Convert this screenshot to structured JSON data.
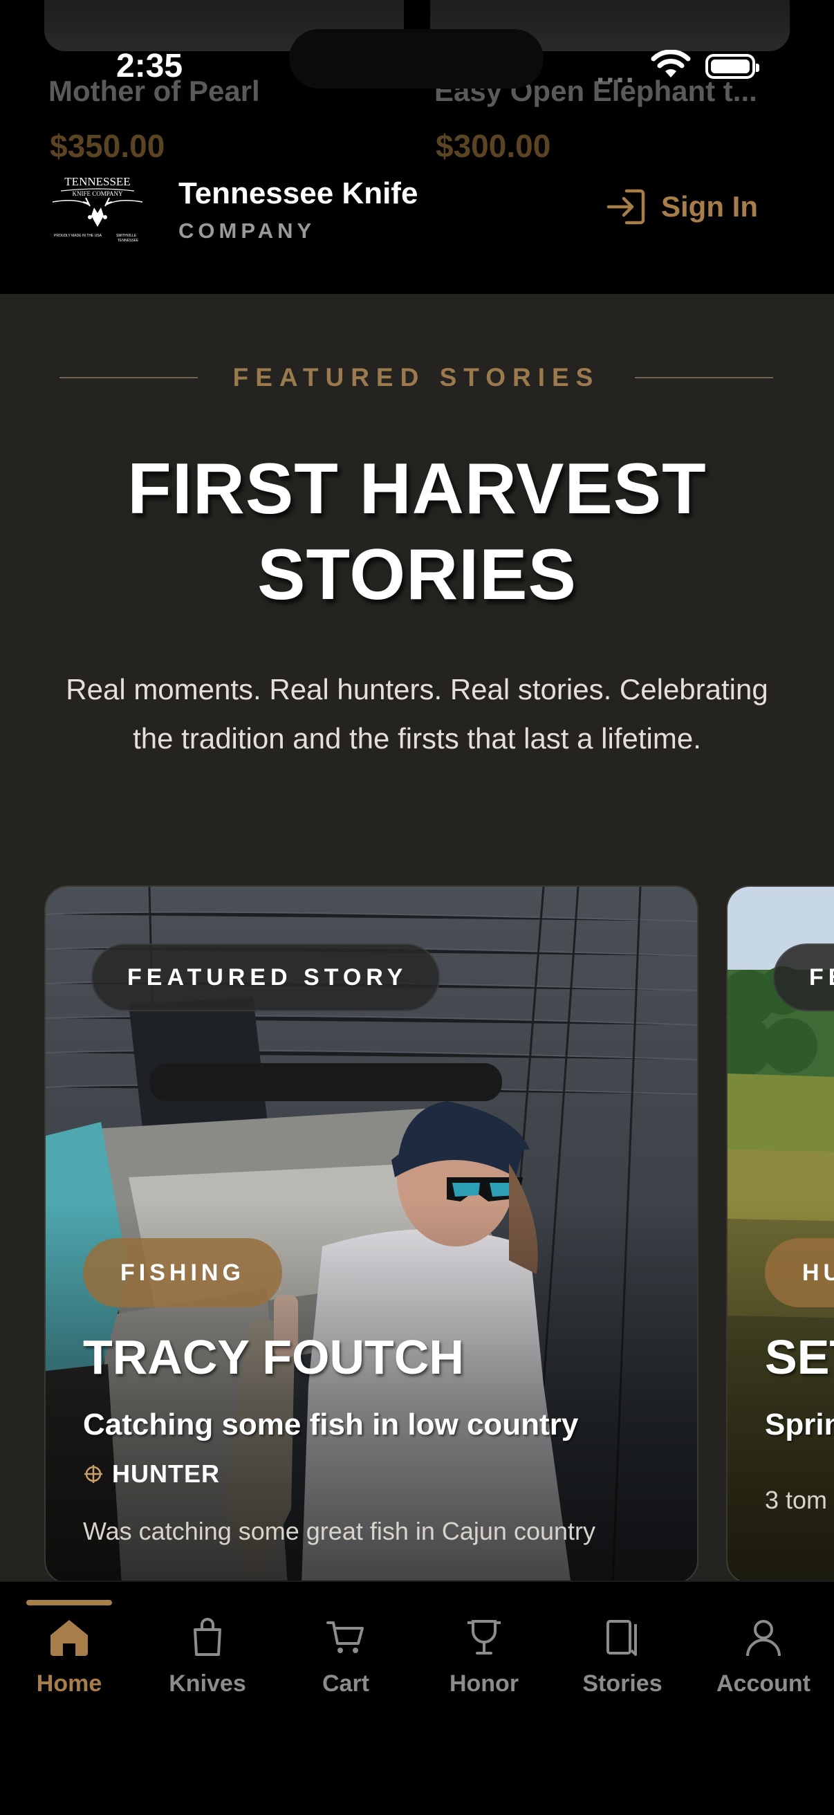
{
  "status_bar": {
    "time": "2:35"
  },
  "scrolled_products": [
    {
      "name": "Mother of Pearl",
      "price": "$350.00"
    },
    {
      "name": "Easy Open Elephant t...",
      "price": "$300.00"
    }
  ],
  "header": {
    "brand_name": "Tennessee Knife",
    "brand_sub": "COMPANY",
    "logo_text": "TENNESSEE KNIFE COMPANY",
    "sign_in_label": "Sign In",
    "accent_color": "#a77e49"
  },
  "section": {
    "eyebrow": "FEATURED STORIES",
    "title_line1": "FIRST HARVEST",
    "title_line2": "STORIES",
    "subtitle": "Real moments. Real hunters. Real stories. Celebrating the tradition and the firsts that last a lifetime."
  },
  "stories": [
    {
      "badge": "FEATURED STORY",
      "category": "FISHING",
      "name": "TRACY FOUTCH",
      "headline": "Catching some fish in low country",
      "role": "HUNTER",
      "description": "Was catching some great fish in Cajun country",
      "photo_icon": "fishing-photo"
    },
    {
      "badge": "FE",
      "category": "HU",
      "name": "SET",
      "headline": "Sprin",
      "description": "3 tom",
      "photo_icon": "field-photo"
    }
  ],
  "tabs": [
    {
      "label": "Home",
      "icon": "home-icon",
      "active": true
    },
    {
      "label": "Knives",
      "icon": "bag-icon",
      "active": false
    },
    {
      "label": "Cart",
      "icon": "cart-icon",
      "active": false
    },
    {
      "label": "Honor",
      "icon": "trophy-icon",
      "active": false
    },
    {
      "label": "Stories",
      "icon": "book-icon",
      "active": false
    },
    {
      "label": "Account",
      "icon": "person-icon",
      "active": false
    }
  ]
}
